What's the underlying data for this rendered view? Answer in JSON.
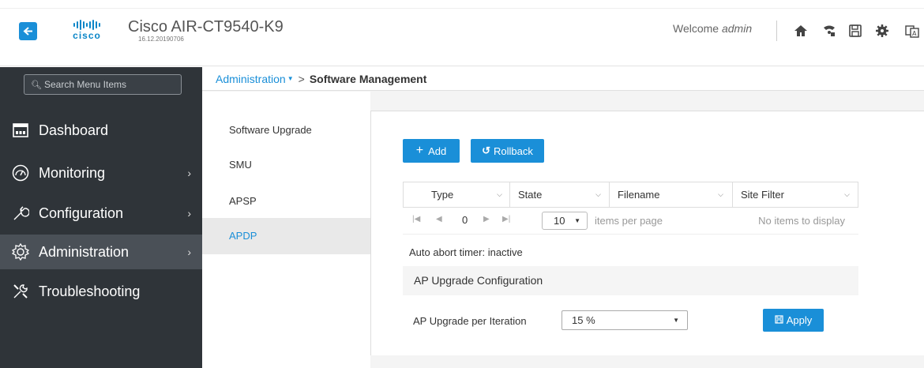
{
  "header": {
    "brand": "cisco",
    "title": "Cisco AIR-CT9540-K9",
    "version": "16.12.20190706",
    "welcome_prefix": "Welcome",
    "user": "admin",
    "icons": [
      "home-icon",
      "wireless-icon",
      "save-icon",
      "gear-icon",
      "translate-icon"
    ]
  },
  "sidebar": {
    "search_placeholder": "Search Menu Items",
    "items": [
      {
        "label": "Dashboard",
        "icon": "dashboard-icon",
        "has_chevron": false
      },
      {
        "label": "Monitoring",
        "icon": "monitoring-icon",
        "has_chevron": true
      },
      {
        "label": "Configuration",
        "icon": "configuration-icon",
        "has_chevron": true
      },
      {
        "label": "Administration",
        "icon": "administration-icon",
        "has_chevron": true,
        "active": true
      },
      {
        "label": "Troubleshooting",
        "icon": "troubleshooting-icon",
        "has_chevron": false
      }
    ],
    "chevron": "›"
  },
  "breadcrumb": {
    "parent": "Administration",
    "separator": ">",
    "current": "Software Management"
  },
  "subnav": {
    "items": [
      {
        "label": "Software Upgrade"
      },
      {
        "label": "SMU"
      },
      {
        "label": "APSP"
      },
      {
        "label": "APDP",
        "active": true
      }
    ]
  },
  "toolbar": {
    "add_label": "Add",
    "rollback_label": "Rollback"
  },
  "table": {
    "columns": [
      "Type",
      "State",
      "Filename",
      "Site Filter"
    ],
    "page_number": "0",
    "per_page": "10",
    "per_page_label": "items per page",
    "empty_text": "No items to display"
  },
  "abort_timer": "Auto abort timer: inactive",
  "ap_upgrade": {
    "section_title": "AP Upgrade Configuration",
    "per_iteration_label": "AP Upgrade per Iteration",
    "per_iteration_value": "15 %",
    "apply_label": "Apply"
  },
  "colors": {
    "accent": "#1a8fd8",
    "sidebar_bg": "#2f3439",
    "sidebar_active": "#4a5057"
  }
}
